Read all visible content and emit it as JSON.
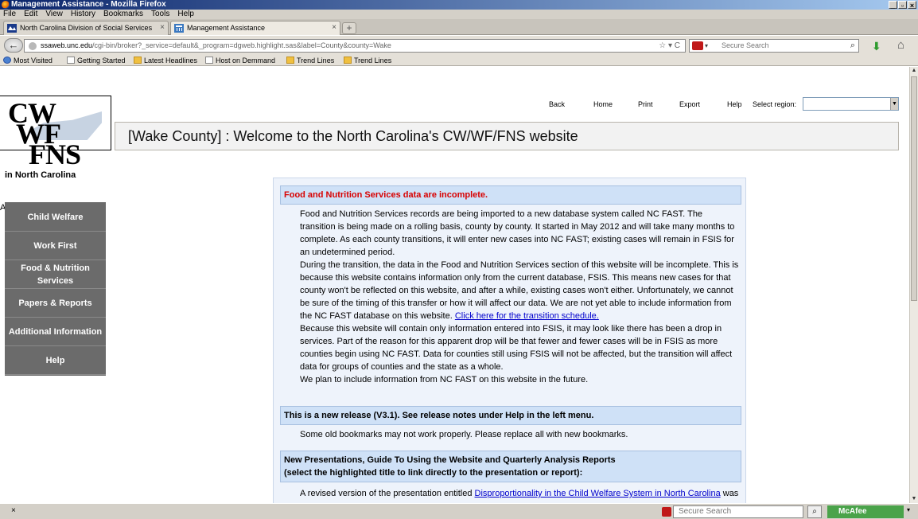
{
  "window": {
    "title": "Management Assistance - Mozilla Firefox",
    "buttons": [
      "_",
      "▫",
      "×"
    ]
  },
  "menubar": [
    "File",
    "Edit",
    "View",
    "History",
    "Bookmarks",
    "Tools",
    "Help"
  ],
  "tabs": [
    {
      "label": "North Carolina Division of Social Services",
      "close": "×"
    },
    {
      "label": "Management Assistance",
      "close": "×"
    }
  ],
  "new_tab": "+",
  "navbar": {
    "url_host": "ssaweb.unc.edu",
    "url_prefix": "",
    "url_rest": "/cgi-bin/broker?_service=default&_program=dgweb.highlight.sas&label=County&county=Wake",
    "url_controls": "☆ ▾ C",
    "search_placeholder": "Secure Search",
    "search_engine_caret": "▾",
    "search_icon": "⌕",
    "download_icon": "⬇",
    "home_icon": "⌂",
    "back_icon": "←"
  },
  "bookmarks": [
    "Most Visited",
    "Getting Started",
    "Latest Headlines",
    "Host on Demmand",
    "Trend Lines",
    "Trend Lines"
  ],
  "logo": {
    "line1": "CW",
    "line2": "WF",
    "line3": "FNS",
    "line4": "in North Carolina"
  },
  "stray_letter": "A",
  "side_menu": [
    {
      "label": "Child Welfare"
    },
    {
      "label": "Work First"
    },
    {
      "label": "Food & Nutrition Services"
    },
    {
      "label": "Papers & Reports"
    },
    {
      "label": "Additional Information"
    },
    {
      "label": "Help"
    }
  ],
  "top_nav": {
    "back": "Back",
    "home": "Home",
    "print": "Print",
    "export": "Export",
    "help": "Help",
    "region_label": "Select region:",
    "region_value": "",
    "caret": "▼"
  },
  "banner": "[Wake County] : Welcome to the North Carolina's CW/WF/FNS website",
  "notice": {
    "head1": "Food and Nutrition Services data are incomplete.",
    "p1": "Food and Nutrition Services records are being imported to a new database system called NC FAST. The transition is being made on a rolling basis, county by county. It started in May 2012 and will take many months to complete. As each county transitions, it will enter new cases into NC FAST; existing cases will remain in FSIS for an undetermined period.",
    "p2a": "During the transition, the data in the Food and Nutrition Services section of this website will be incomplete. This is because this website contains information only from the current database, FSIS. This means new cases for that county won't be reflected on this website, and after a while, existing cases won't either. Unfortunately, we cannot be sure of the timing of this transfer or how it will affect our data. We are not yet able to include information from the NC FAST database on this website. ",
    "p2_link": "Click here for the transition schedule.",
    "p3": "Because this website will contain only information entered into FSIS, it may look like there has been a drop in services. Part of the reason for this apparent drop will be that fewer and fewer cases will be in FSIS as more counties begin using NC FAST. Data for counties still using FSIS will not be affected, but the transition will affect data for groups of counties and the state as a whole.",
    "p4": "We plan to include information from NC FAST on this website in the future.",
    "head2": "This is a new release (V3.1). See release notes under Help in the left menu.",
    "p5": "Some old bookmarks may not work properly. Please replace all with new bookmarks.",
    "head3_line1": "New Presentations, Guide To Using the Website and Quarterly Analysis Reports",
    "head3_line2": "(select the highlighted title to link directly to the presentation or report):",
    "p6a": "A revised version of the presentation entitled ",
    "p6_link": "Disproportionality in the Child Welfare System in North Carolina",
    "p6b": " was"
  },
  "statusbar": {
    "close": "×",
    "search_placeholder": "Secure Search",
    "search_icon": "⌕",
    "mcafee": "McAfee",
    "caret": "▾"
  }
}
